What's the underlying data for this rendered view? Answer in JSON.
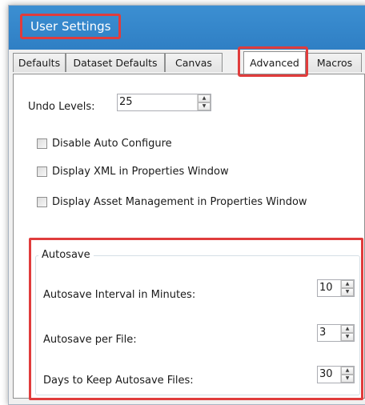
{
  "window": {
    "title": "User Settings"
  },
  "tabs": [
    {
      "label": "Defaults"
    },
    {
      "label": "Dataset Defaults"
    },
    {
      "label": "Canvas"
    },
    {
      "label": "Advanced",
      "active": true
    },
    {
      "label": "Macros"
    }
  ],
  "advanced": {
    "undo_levels": {
      "label": "Undo Levels:",
      "value": "25"
    },
    "checkboxes": [
      {
        "label": "Disable Auto Configure",
        "checked": false
      },
      {
        "label": "Display XML in Properties Window",
        "checked": false
      },
      {
        "label": "Display Asset Management in Properties Window",
        "checked": false
      }
    ],
    "autosave": {
      "group_title": "Autosave",
      "interval": {
        "label": "Autosave Interval in Minutes:",
        "value": "10"
      },
      "per_file": {
        "label": "Autosave per File:",
        "value": "3"
      },
      "days_keep": {
        "label": "Days to Keep Autosave Files:",
        "value": "30"
      }
    }
  },
  "colors": {
    "titlebar": "#2f7fc4",
    "highlight": "#e03c3c"
  },
  "icons": {
    "spin_up": "triangle-up",
    "spin_down": "triangle-down"
  }
}
